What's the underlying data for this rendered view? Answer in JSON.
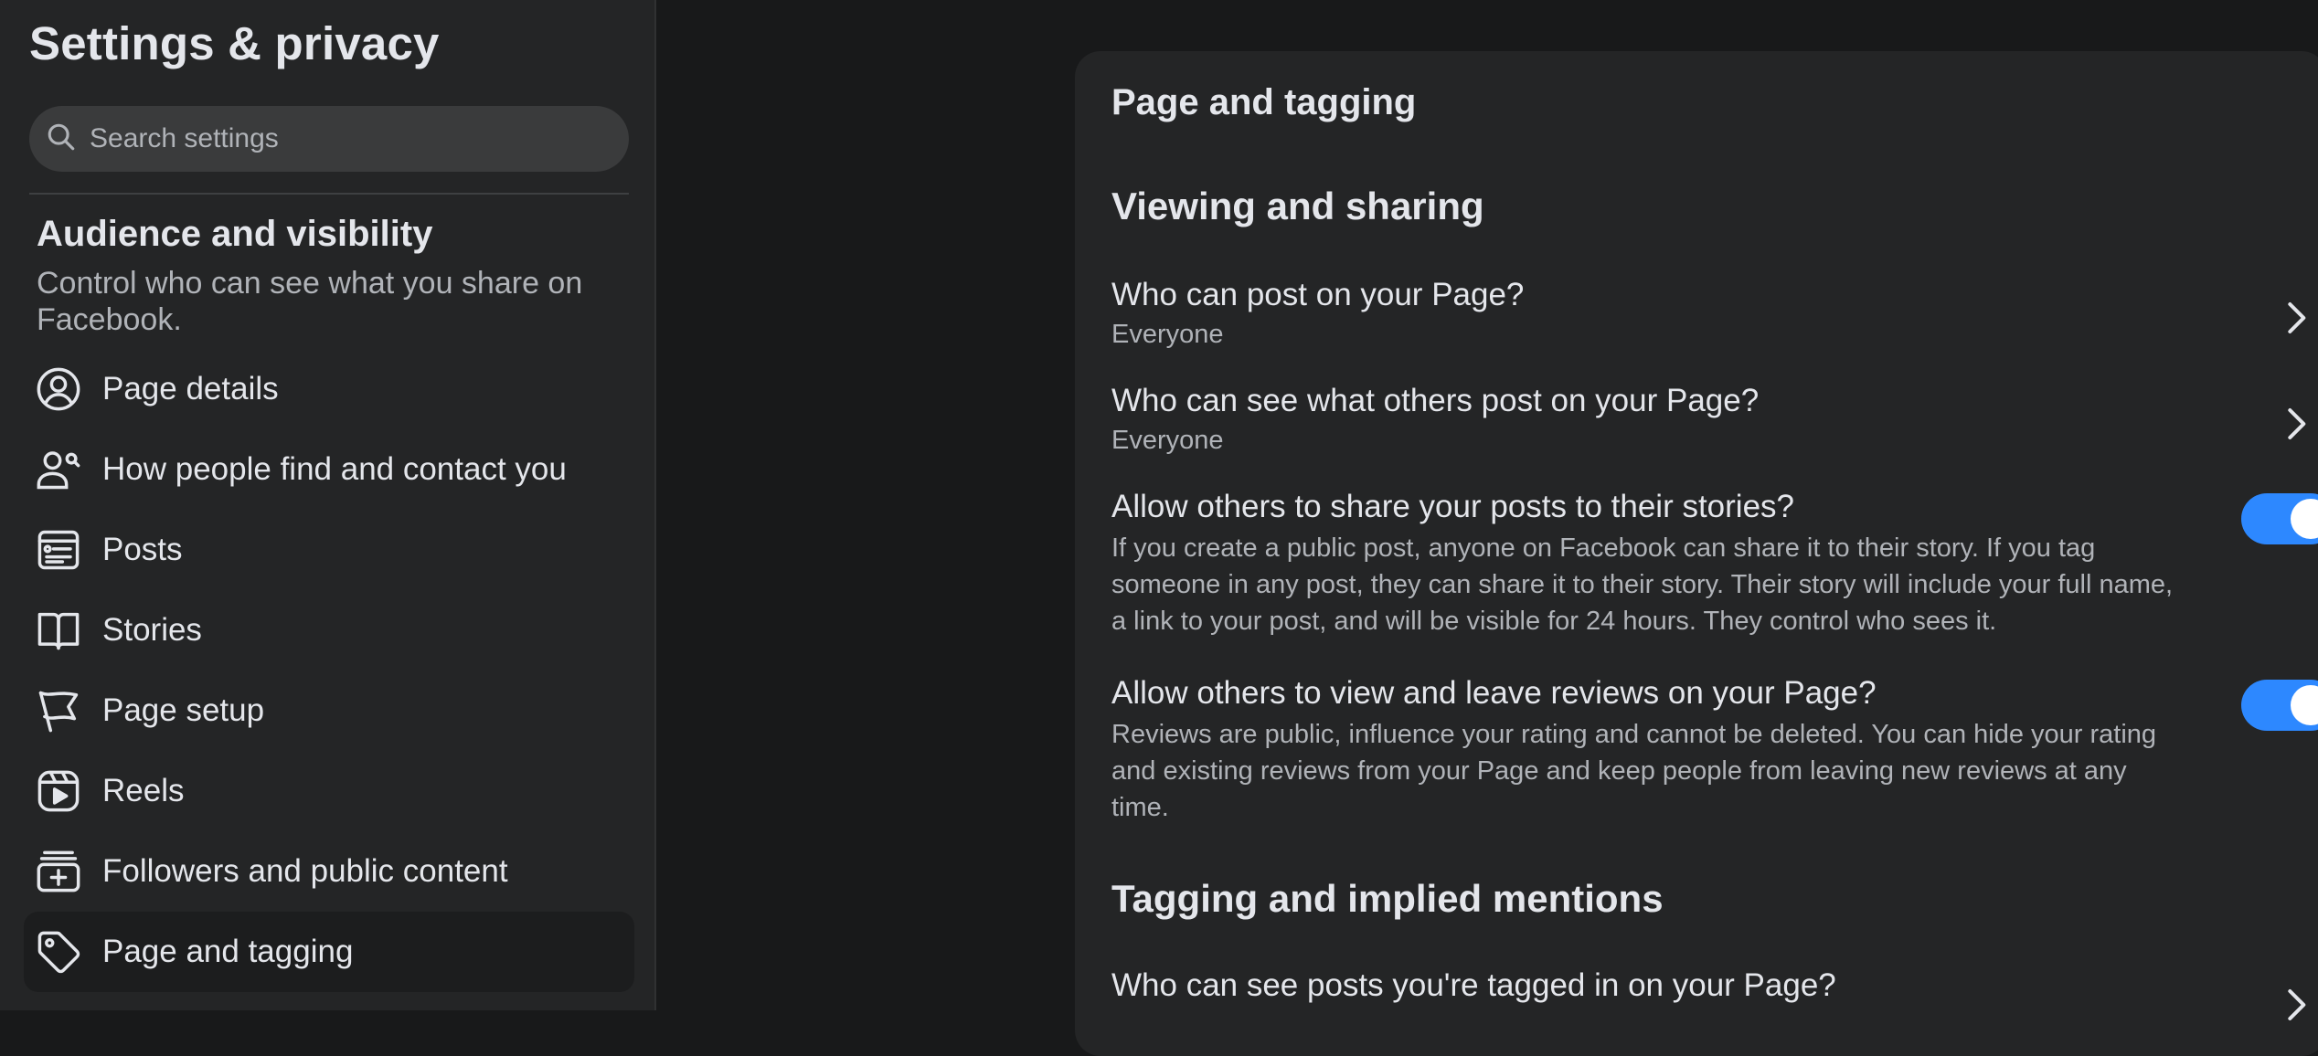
{
  "sidebar": {
    "title": "Settings & privacy",
    "search_placeholder": "Search settings",
    "section_title": "Audience and visibility",
    "section_desc": "Control who can see what you share on Facebook.",
    "items": [
      {
        "label": "Page details",
        "icon": "user-circle-icon"
      },
      {
        "label": "How people find and contact you",
        "icon": "people-search-icon"
      },
      {
        "label": "Posts",
        "icon": "posts-icon"
      },
      {
        "label": "Stories",
        "icon": "book-icon"
      },
      {
        "label": "Page setup",
        "icon": "flag-icon"
      },
      {
        "label": "Reels",
        "icon": "reels-icon"
      },
      {
        "label": "Followers and public content",
        "icon": "followers-icon"
      },
      {
        "label": "Page and tagging",
        "icon": "tag-icon",
        "active": true
      }
    ]
  },
  "main": {
    "card_title": "Page and tagging",
    "viewing": {
      "title": "Viewing and sharing",
      "who_post": {
        "title": "Who can post on your Page?",
        "value": "Everyone"
      },
      "who_see": {
        "title": "Who can see what others post on your Page?",
        "value": "Everyone"
      },
      "share_stories": {
        "title": "Allow others to share your posts to their stories?",
        "desc": "If you create a public post, anyone on Facebook can share it to their story. If you tag someone in any post, they can share it to their story. Their story will include your full name, a link to your post, and will be visible for 24 hours. They control who sees it.",
        "enabled": true
      },
      "reviews": {
        "title": "Allow others to view and leave reviews on your Page?",
        "desc": "Reviews are public, influence your rating and cannot be deleted. You can hide your rating and existing reviews from your Page and keep people from leaving new reviews at any time.",
        "enabled": true
      }
    },
    "tagging": {
      "title": "Tagging and implied mentions",
      "who_tagged": {
        "title": "Who can see posts you're tagged in on your Page?"
      }
    }
  },
  "colors": {
    "accent": "#2d88ff",
    "sidebar_bg": "#242526",
    "page_bg": "#18191a",
    "text_primary": "#e4e6eb",
    "text_secondary": "#b0b3b8"
  }
}
